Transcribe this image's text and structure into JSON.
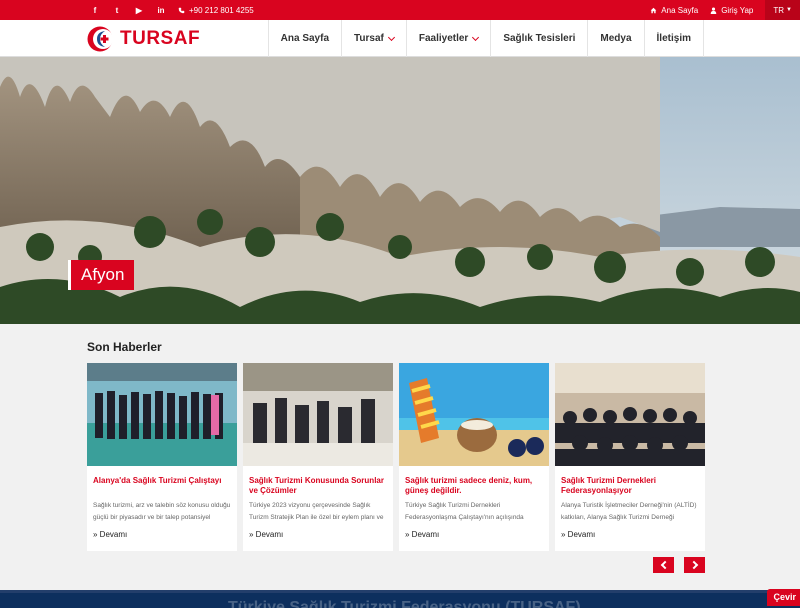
{
  "topbar": {
    "social": [
      {
        "name": "facebook-icon",
        "glyph": "f"
      },
      {
        "name": "twitter-icon",
        "glyph": "t"
      },
      {
        "name": "youtube-icon",
        "glyph": "▶"
      },
      {
        "name": "linkedin-icon",
        "glyph": "in"
      }
    ],
    "phone": "+90 212 801 4255",
    "home_link": "Ana Sayfa",
    "login_link": "Giriş Yap",
    "language": "TR"
  },
  "header": {
    "logo_text": "TURSAF",
    "nav": [
      {
        "label": "Ana Sayfa",
        "dropdown": false
      },
      {
        "label": "Tursaf",
        "dropdown": true
      },
      {
        "label": "Faaliyetler",
        "dropdown": true
      },
      {
        "label": "Sağlık Tesisleri",
        "dropdown": false
      },
      {
        "label": "Medya",
        "dropdown": false
      },
      {
        "label": "İletişim",
        "dropdown": false
      }
    ]
  },
  "hero": {
    "caption": "Afyon",
    "slide_count": 13,
    "active_slide": 3
  },
  "news": {
    "section_title": "Son Haberler",
    "items": [
      {
        "title": "Alanya'da Sağlık Turizmi Çalıştayı",
        "description": "Sağlık turizmi, arz ve talebin söz konusu olduğu güçlü bir piyasadır ve bir talep potansiyel",
        "more": "» Devamı"
      },
      {
        "title": "Sağlık Turizmi Konusunda Sorunlar ve Çözümler",
        "description": "Türkiye 2023 vizyonu çerçevesinde Sağlık Turizm Stratejik Plan ile özel bir eylem planı ve",
        "more": "» Devamı"
      },
      {
        "title": "Sağlık turizmi sadece deniz, kum, güneş değildir.",
        "description": "Türkiye Sağlık Turizmi Dernekleri Federasyonlaşma Çalıştayı'nın açılışında konuşan",
        "more": "» Devamı"
      },
      {
        "title": "Sağlık Turizmi Dernekleri Federasyonlaşıyor",
        "description": "Alanya Turistik İşletmeciler Derneği'nin (ALTİD) katkıları, Alanya Sağlık Turizmi Derneği",
        "more": "» Devamı"
      }
    ]
  },
  "footer": {
    "text": "Türkiye Sağlık Turizmi Federasyonu (TURSAF)",
    "translate_button": "Çevir"
  },
  "colors": {
    "brand": "#d9041f",
    "footer": "#0d2f5e"
  }
}
